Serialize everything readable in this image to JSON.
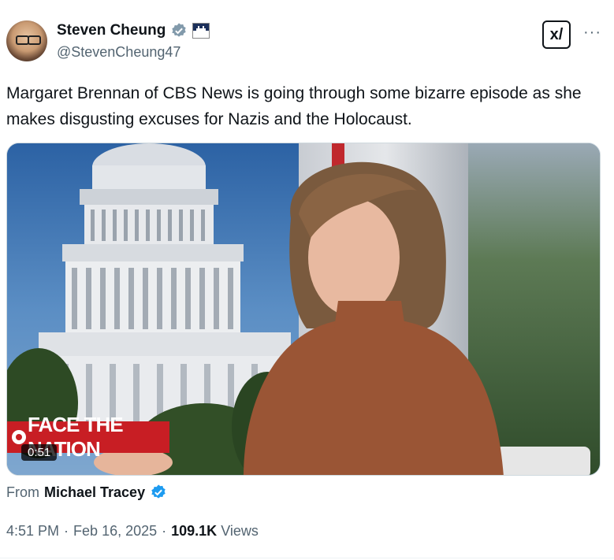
{
  "author": {
    "name": "Steven Cheung",
    "handle": "@StevenCheung47",
    "verified_badge": "gray-verified-icon",
    "flag_icon": "flag-icon"
  },
  "post": {
    "text": "Margaret Brennan of CBS News is going through some bizarre episode as she makes disgusting excuses for Nazis and the Holocaust."
  },
  "media": {
    "type": "video",
    "overlay_logo": "FACE THE NATION",
    "duration": "0:51"
  },
  "source": {
    "prefix": "From",
    "name": "Michael Tracey",
    "verified_badge": "blue-verified-icon"
  },
  "meta": {
    "time": "4:51 PM",
    "sep1": "·",
    "date": "Feb 16, 2025",
    "sep2": "·",
    "views_count": "109.1K",
    "views_label": "Views"
  },
  "actions": {
    "grok_label": "x/",
    "more_label": "···"
  },
  "colors": {
    "text": "#0f1419",
    "secondary": "#536471",
    "verified_blue": "#1d9bf0",
    "verified_gray": "#829aab",
    "cbs_red": "#c81e24"
  }
}
